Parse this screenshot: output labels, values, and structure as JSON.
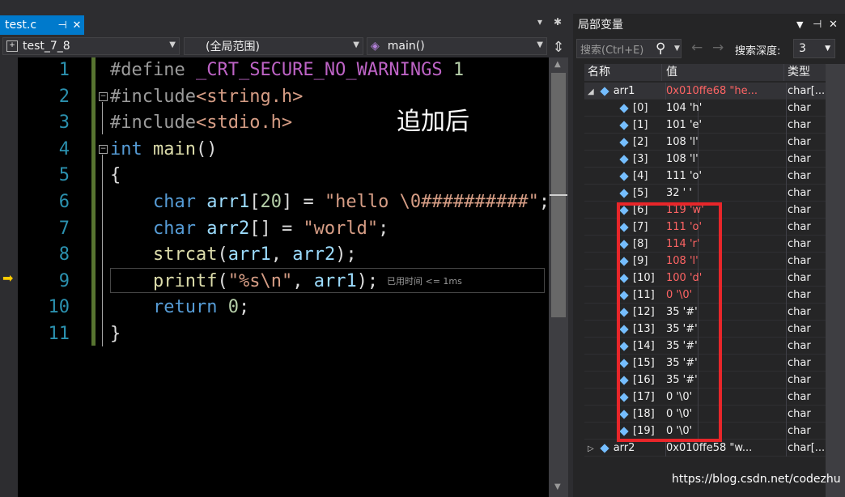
{
  "editor": {
    "tab_label": "test.c",
    "pin_icon": "pin-icon",
    "close_icon": "close-icon",
    "project_combo": "test_7_8",
    "scope_combo": "(全局范围)",
    "function_combo": "main()",
    "annotation": "追加后",
    "perf_tip": "已用时间 <= 1ms",
    "line_numbers": [
      "1",
      "2",
      "3",
      "4",
      "5",
      "6",
      "7",
      "8",
      "9",
      "10",
      "11"
    ],
    "lines": [
      "#define _CRT_SECURE_NO_WARNINGS 1",
      "#include<string.h>",
      "#include<stdio.h>",
      "int main()",
      "{",
      "    char arr1[20] = \"hello \\0##########\";",
      "    char arr2[] = \"world\";",
      "    strcat(arr1, arr2);",
      "    printf(\"%s\\n\", arr1);",
      "    return 0;",
      "}"
    ]
  },
  "locals": {
    "title": "局部变量",
    "search_placeholder": "搜索(Ctrl+E)",
    "depth_label": "搜索深度:",
    "depth_value": "3",
    "columns": [
      "名称",
      "值",
      "类型"
    ],
    "rows": [
      {
        "name": "arr1",
        "value": "0x010ffe68 \"he...",
        "type": "char[...",
        "changed": true,
        "expanded": true
      },
      {
        "name": "[0]",
        "value": "104 'h'",
        "type": "char",
        "changed": false
      },
      {
        "name": "[1]",
        "value": "101 'e'",
        "type": "char",
        "changed": false
      },
      {
        "name": "[2]",
        "value": "108 'l'",
        "type": "char",
        "changed": false
      },
      {
        "name": "[3]",
        "value": "108 'l'",
        "type": "char",
        "changed": false
      },
      {
        "name": "[4]",
        "value": "111 'o'",
        "type": "char",
        "changed": false
      },
      {
        "name": "[5]",
        "value": "32 ' '",
        "type": "char",
        "changed": false
      },
      {
        "name": "[6]",
        "value": "119 'w'",
        "type": "char",
        "changed": true
      },
      {
        "name": "[7]",
        "value": "111 'o'",
        "type": "char",
        "changed": true
      },
      {
        "name": "[8]",
        "value": "114 'r'",
        "type": "char",
        "changed": true
      },
      {
        "name": "[9]",
        "value": "108 'l'",
        "type": "char",
        "changed": true
      },
      {
        "name": "[10]",
        "value": "100 'd'",
        "type": "char",
        "changed": true
      },
      {
        "name": "[11]",
        "value": "0 '\\0'",
        "type": "char",
        "changed": true
      },
      {
        "name": "[12]",
        "value": "35 '#'",
        "type": "char",
        "changed": false
      },
      {
        "name": "[13]",
        "value": "35 '#'",
        "type": "char",
        "changed": false
      },
      {
        "name": "[14]",
        "value": "35 '#'",
        "type": "char",
        "changed": false
      },
      {
        "name": "[15]",
        "value": "35 '#'",
        "type": "char",
        "changed": false
      },
      {
        "name": "[16]",
        "value": "35 '#'",
        "type": "char",
        "changed": false
      },
      {
        "name": "[17]",
        "value": "0 '\\0'",
        "type": "char",
        "changed": false
      },
      {
        "name": "[18]",
        "value": "0 '\\0'",
        "type": "char",
        "changed": false
      },
      {
        "name": "[19]",
        "value": "0 '\\0'",
        "type": "char",
        "changed": false
      },
      {
        "name": "arr2",
        "value": "0x010ffe58 \"w...",
        "type": "char[...",
        "changed": false,
        "expanded": false
      }
    ]
  },
  "watermark": "https://blog.csdn.net/codezhu"
}
